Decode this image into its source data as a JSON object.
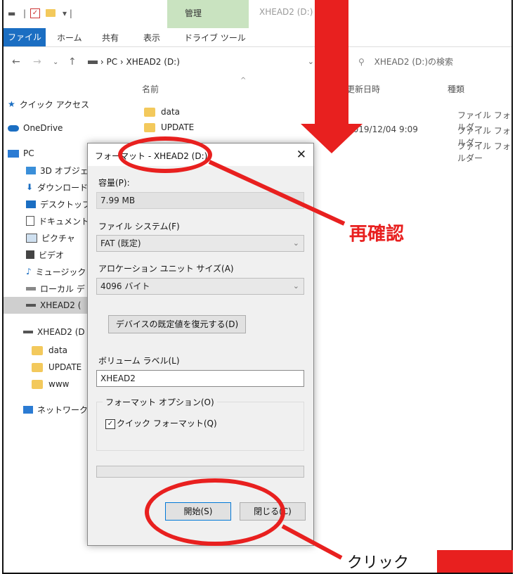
{
  "explorer": {
    "title_context_tab": "管理",
    "window_title": "XHEAD2 (D:)",
    "ribbon_tabs": [
      "ファイル",
      "ホーム",
      "共有",
      "表示",
      "ドライブ ツール"
    ],
    "address": {
      "path": [
        "PC",
        "XHEAD2 (D:)"
      ],
      "search_placeholder": "XHEAD2 (D:)の検索"
    },
    "nav_items": [
      "クイック アクセス",
      "OneDrive",
      "PC",
      "3D オブジェ",
      "ダウンロード",
      "デスクトップ",
      "ドキュメント",
      "ピクチャ",
      "ビデオ",
      "ミュージック",
      "ローカル デ",
      "XHEAD2 (",
      "XHEAD2 (D",
      "data",
      "UPDATE",
      "www",
      "ネットワーク"
    ],
    "columns": {
      "name": "名前",
      "modified": "更新日時",
      "type": "種類"
    },
    "files": [
      {
        "name": "data",
        "date": "",
        "type": "ファイル フォルダー"
      },
      {
        "name": "UPDATE",
        "date": "2019/12/04 9:09",
        "type": "ファイル フォルダー"
      },
      {
        "name": "",
        "date": "",
        "type": "ファイル フォルダー"
      }
    ]
  },
  "dialog": {
    "title": "フォーマット - XHEAD2 (D:)",
    "close": "✕",
    "capacity_label": "容量(P):",
    "capacity_value": "7.99 MB",
    "fs_label": "ファイル システム(F)",
    "fs_value": "FAT (既定)",
    "alloc_label": "アロケーション ユニット サイズ(A)",
    "alloc_value": "4096 バイト",
    "restore_button": "デバイスの既定値を復元する(D)",
    "volume_label": "ボリューム ラベル(L)",
    "volume_value": "XHEAD2",
    "options_title": "フォーマット オプション(O)",
    "quick_format": "クイック フォーマット(Q)",
    "quick_format_checked": true,
    "start_button": "開始(S)",
    "close_button": "閉じる(C)"
  },
  "annotations": {
    "reconfirm": "再確認",
    "click": "クリック",
    "color": "#e8201f"
  },
  "icons": [
    "checkmark-icon",
    "folder-icon",
    "star-icon",
    "cloud-icon",
    "pc-icon",
    "3d-icon",
    "download-icon",
    "desktop-icon",
    "document-icon",
    "picture-icon",
    "video-icon",
    "music-icon",
    "drive-icon",
    "network-icon",
    "search-icon",
    "chevron-down-icon",
    "close-icon"
  ]
}
